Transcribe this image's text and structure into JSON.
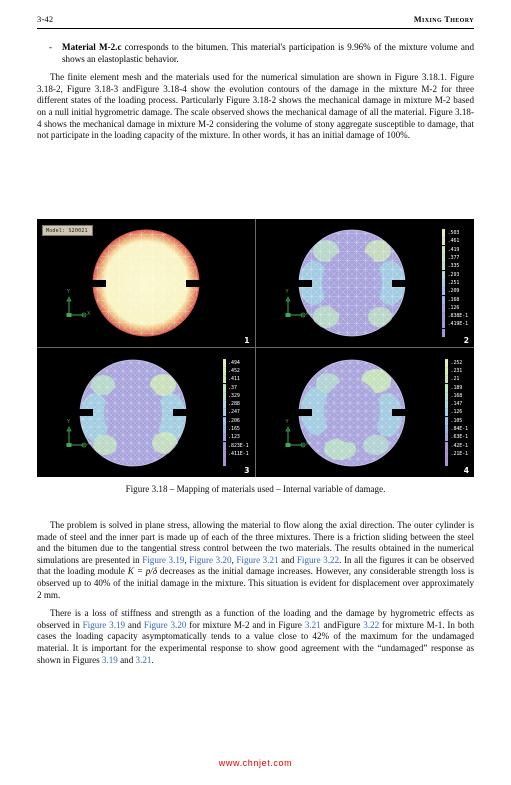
{
  "header": {
    "page_number": "3-42",
    "section_title": "Mixing Theory"
  },
  "bullet": {
    "marker": "-",
    "lead": "Material M-2.c",
    "text": " corresponds to the bitumen. This material's participation is 9.96% of the mixture volume and shows an elastoplastic behavior."
  },
  "paragraphs": {
    "p1_a": "The finite element mesh and the materials used for the numerical simulation are shown in Figure 3.18.1. Figure 3.18-2, Figure 3.18-3 andFigure 3.18-4 show the evolution contours of the damage in the mixture M-2 for three different states of the loading process. Particularly Figure 3.18-2 shows the mechanical damage in mixture M-2 based on a null initial hygrometric damage. The scale observed shows the mechanical damage of all the material. Figure 3.18-4 shows the mechanical damage in mixture M-2 considering the volume of stony aggregate susceptible to damage, that not participate in the loading capacity of the mixture. In other words, it has an initial damage of 100%.",
    "p2_s1": "The problem is solved in plane stress, allowing the material to flow along the axial direction. The outer cylinder is made of steel and the inner part is made up of each of the three mixtures. There is a friction sliding between the steel and the bitumen due to the tangential stress control between the two materials. The results obtained in the numerical simulations are presented in ",
    "p2_ref1": "Figure 3.19",
    "p2_s2": ", ",
    "p2_ref2": "Figure 3.20",
    "p2_s3": ", ",
    "p2_ref3": "Figure 3.21",
    "p2_s4": " and ",
    "p2_ref4": "Figure 3.22",
    "p2_s5": ". In all the figures it can be observed that the loading module ",
    "p2_math": "K = p/δ",
    "p2_s6": " decreases as the initial damage increases. However, any considerable strength loss is observed up to 40% of the initial damage in the mixture. This situation is evident for displacement over approximately 2 mm.",
    "p3_s1": "There is a loss of stiffness and strength as a function of the loading and the damage by hygrometric effects as observed in ",
    "p3_ref1": "Figure 3.19",
    "p3_s2": " and ",
    "p3_ref2": "Figure 3.20",
    "p3_s3": " for mixture M-2 and in Figure ",
    "p3_ref3": "3.21",
    "p3_s4": " andFigure ",
    "p3_ref4": "3.22",
    "p3_s5": " for mixture M-1. In both cases the loading capacity asymptomatically tends to a value close to 42% of the maximum for the undamaged material. It is important for the experimental response to show good agreement with the “undamaged” response as shown in Figures ",
    "p3_ref5": "3.19",
    "p3_s6": " and ",
    "p3_ref6": "3.21",
    "p3_s7": "."
  },
  "figure": {
    "caption": "Figure 3.18 – Mapping of materials used – Internal variable of damage.",
    "model_tag": "Model: S20021",
    "axis_y": "Y",
    "axis_x": "X",
    "panels": [
      {
        "number": "1",
        "kind": "material-map",
        "legend": []
      },
      {
        "number": "2",
        "kind": "damage-contour",
        "legend": [
          ".503",
          ".461",
          ".419",
          ".377",
          ".335",
          ".293",
          ".251",
          ".209",
          ".168",
          ".126",
          ".838E-1",
          ".419E-1"
        ]
      },
      {
        "number": "3",
        "kind": "damage-contour",
        "legend": [
          ".494",
          ".452",
          ".411",
          ".37",
          ".329",
          ".288",
          ".247",
          ".206",
          ".165",
          ".123",
          ".823E-1",
          ".411E-1"
        ]
      },
      {
        "number": "4",
        "kind": "damage-contour",
        "legend": [
          ".252",
          ".231",
          ".21",
          ".189",
          ".168",
          ".147",
          ".126",
          ".105",
          ".84E-1",
          ".63E-1",
          ".42E-1",
          ".21E-1"
        ]
      }
    ],
    "legend_colors": [
      "#e4f0b4",
      "#d8ecb0",
      "#cbe8b2",
      "#c2e6bd",
      "#b7e2cc",
      "#addbdd",
      "#a6cfe6",
      "#a2c0e8",
      "#a3b2e2",
      "#a5a5dc",
      "#a79ad4",
      "#a894cf"
    ]
  },
  "footer": {
    "watermark": "www.chnjet.com"
  },
  "colors": {
    "link": "#3465c4",
    "watermark": "#ee0000",
    "figure_background": "#000000"
  }
}
